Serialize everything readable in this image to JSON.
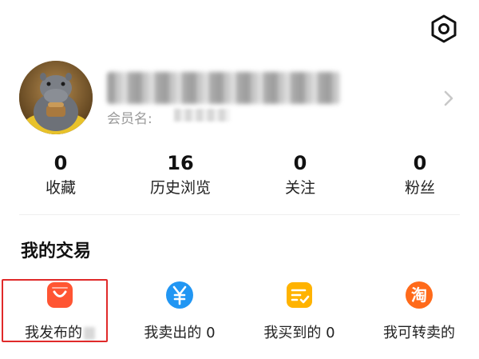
{
  "header": {
    "settings_icon": "settings-hexagon-icon"
  },
  "profile": {
    "avatar_icon": "hippo-avatar",
    "member_label": "会员名:",
    "chevron_icon": "chevron-right-icon"
  },
  "stats": [
    {
      "value": "0",
      "label": "收藏"
    },
    {
      "value": "16",
      "label": "历史浏览"
    },
    {
      "value": "0",
      "label": "关注"
    },
    {
      "value": "0",
      "label": "粉丝"
    }
  ],
  "trades": {
    "title": "我的交易",
    "items": [
      {
        "label": "我发布的",
        "icon": "shopping-bag-icon",
        "color": "#ff5533"
      },
      {
        "label": "我卖出的 0",
        "icon": "yen-icon",
        "color": "#2196f3"
      },
      {
        "label": "我买到的 0",
        "icon": "checklist-icon",
        "color": "#ffb300"
      },
      {
        "label": "我可转卖的",
        "icon": "taobao-icon",
        "color": "#ff6a1a"
      }
    ]
  },
  "colors": {
    "highlight": "#e02a2a"
  }
}
